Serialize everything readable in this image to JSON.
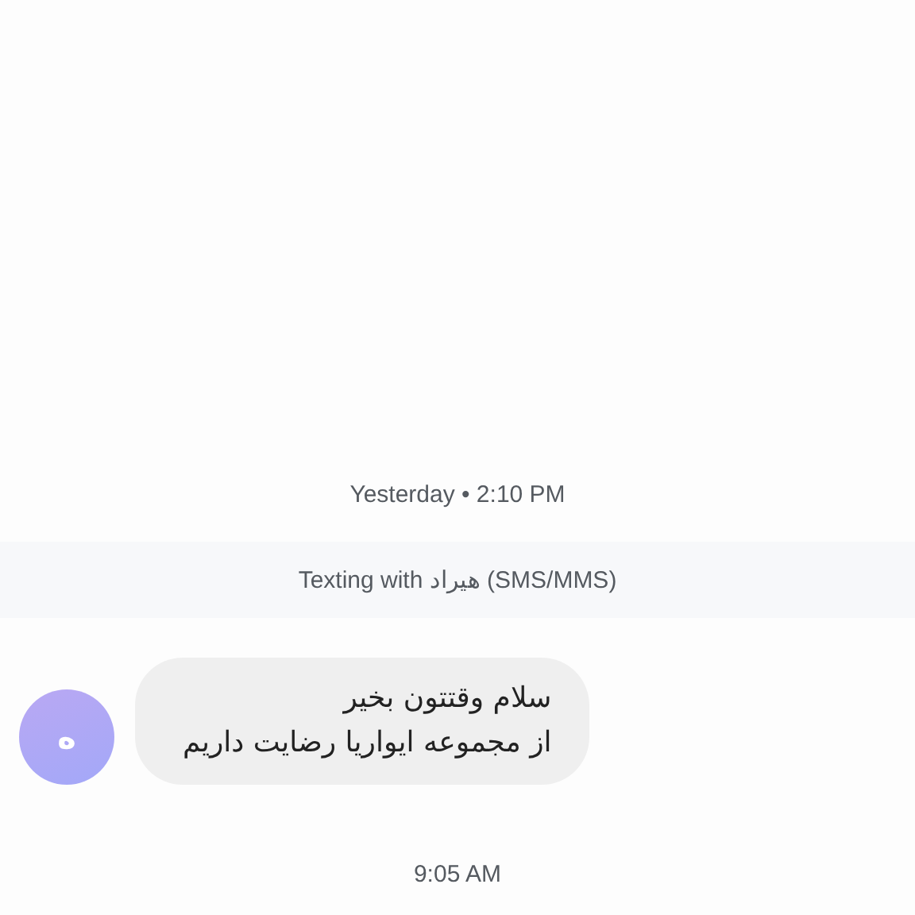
{
  "date_divider": "Yesterday • 2:10 PM",
  "banner": "Texting with هیراد (SMS/MMS)",
  "messages": [
    {
      "avatar": "ه",
      "text": "سلام وقتتون بخیر\nاز مجموعه ایواریا رضایت داریم"
    }
  ],
  "time_divider": "9:05 AM"
}
